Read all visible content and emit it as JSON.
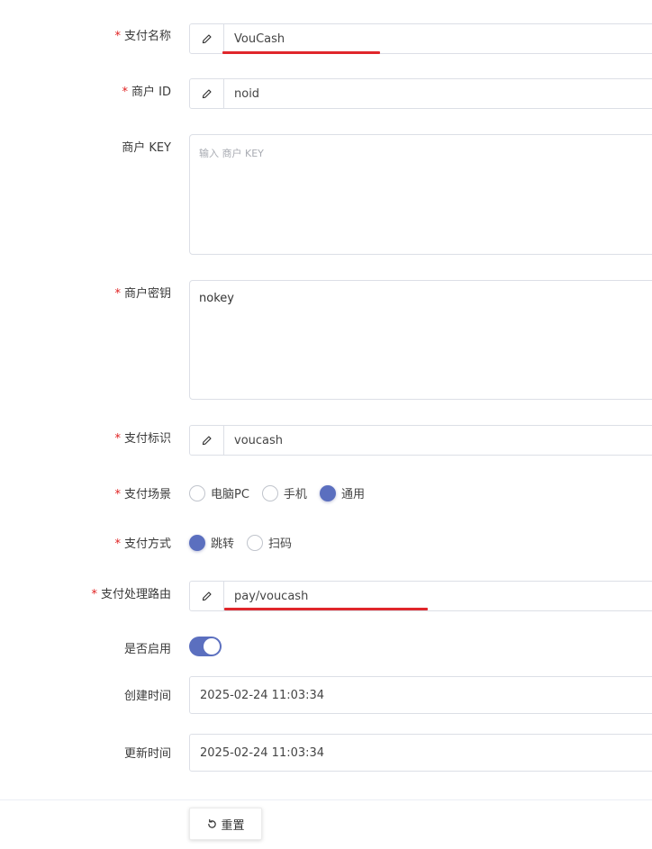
{
  "form": {
    "required_mark": "*",
    "pay_name": {
      "label": "支付名称",
      "value": "VouCash",
      "required": true
    },
    "merchant_id": {
      "label": "商户 ID",
      "value": "noid",
      "required": true
    },
    "merchant_key": {
      "label": "商户 KEY",
      "placeholder": "输入 商户 KEY",
      "required": false
    },
    "merchant_secret": {
      "label": "商户密钥",
      "value": "nokey",
      "required": true
    },
    "pay_tag": {
      "label": "支付标识",
      "value": "voucash",
      "required": true
    },
    "pay_scene": {
      "label": "支付场景",
      "options": [
        "电脑PC",
        "手机",
        "通用"
      ],
      "selected": "通用"
    },
    "pay_method": {
      "label": "支付方式",
      "options": [
        "跳转",
        "扫码"
      ],
      "selected": "跳转"
    },
    "pay_route": {
      "label": "支付处理路由",
      "value": "pay/voucash",
      "required": true
    },
    "enabled": {
      "label": "是否启用",
      "value": true
    },
    "created_at": {
      "label": "创建时间",
      "value": "2025-02-24 11:03:34"
    },
    "updated_at": {
      "label": "更新时间",
      "value": "2025-02-24 11:03:34"
    }
  },
  "actions": {
    "reset_label": "重置"
  },
  "colors": {
    "accent": "#5b6fbf",
    "highlight_underline": "#e0262b",
    "required": "#e02020"
  },
  "icons": {
    "field_addon": "pencil-icon",
    "reset": "refresh-icon"
  }
}
